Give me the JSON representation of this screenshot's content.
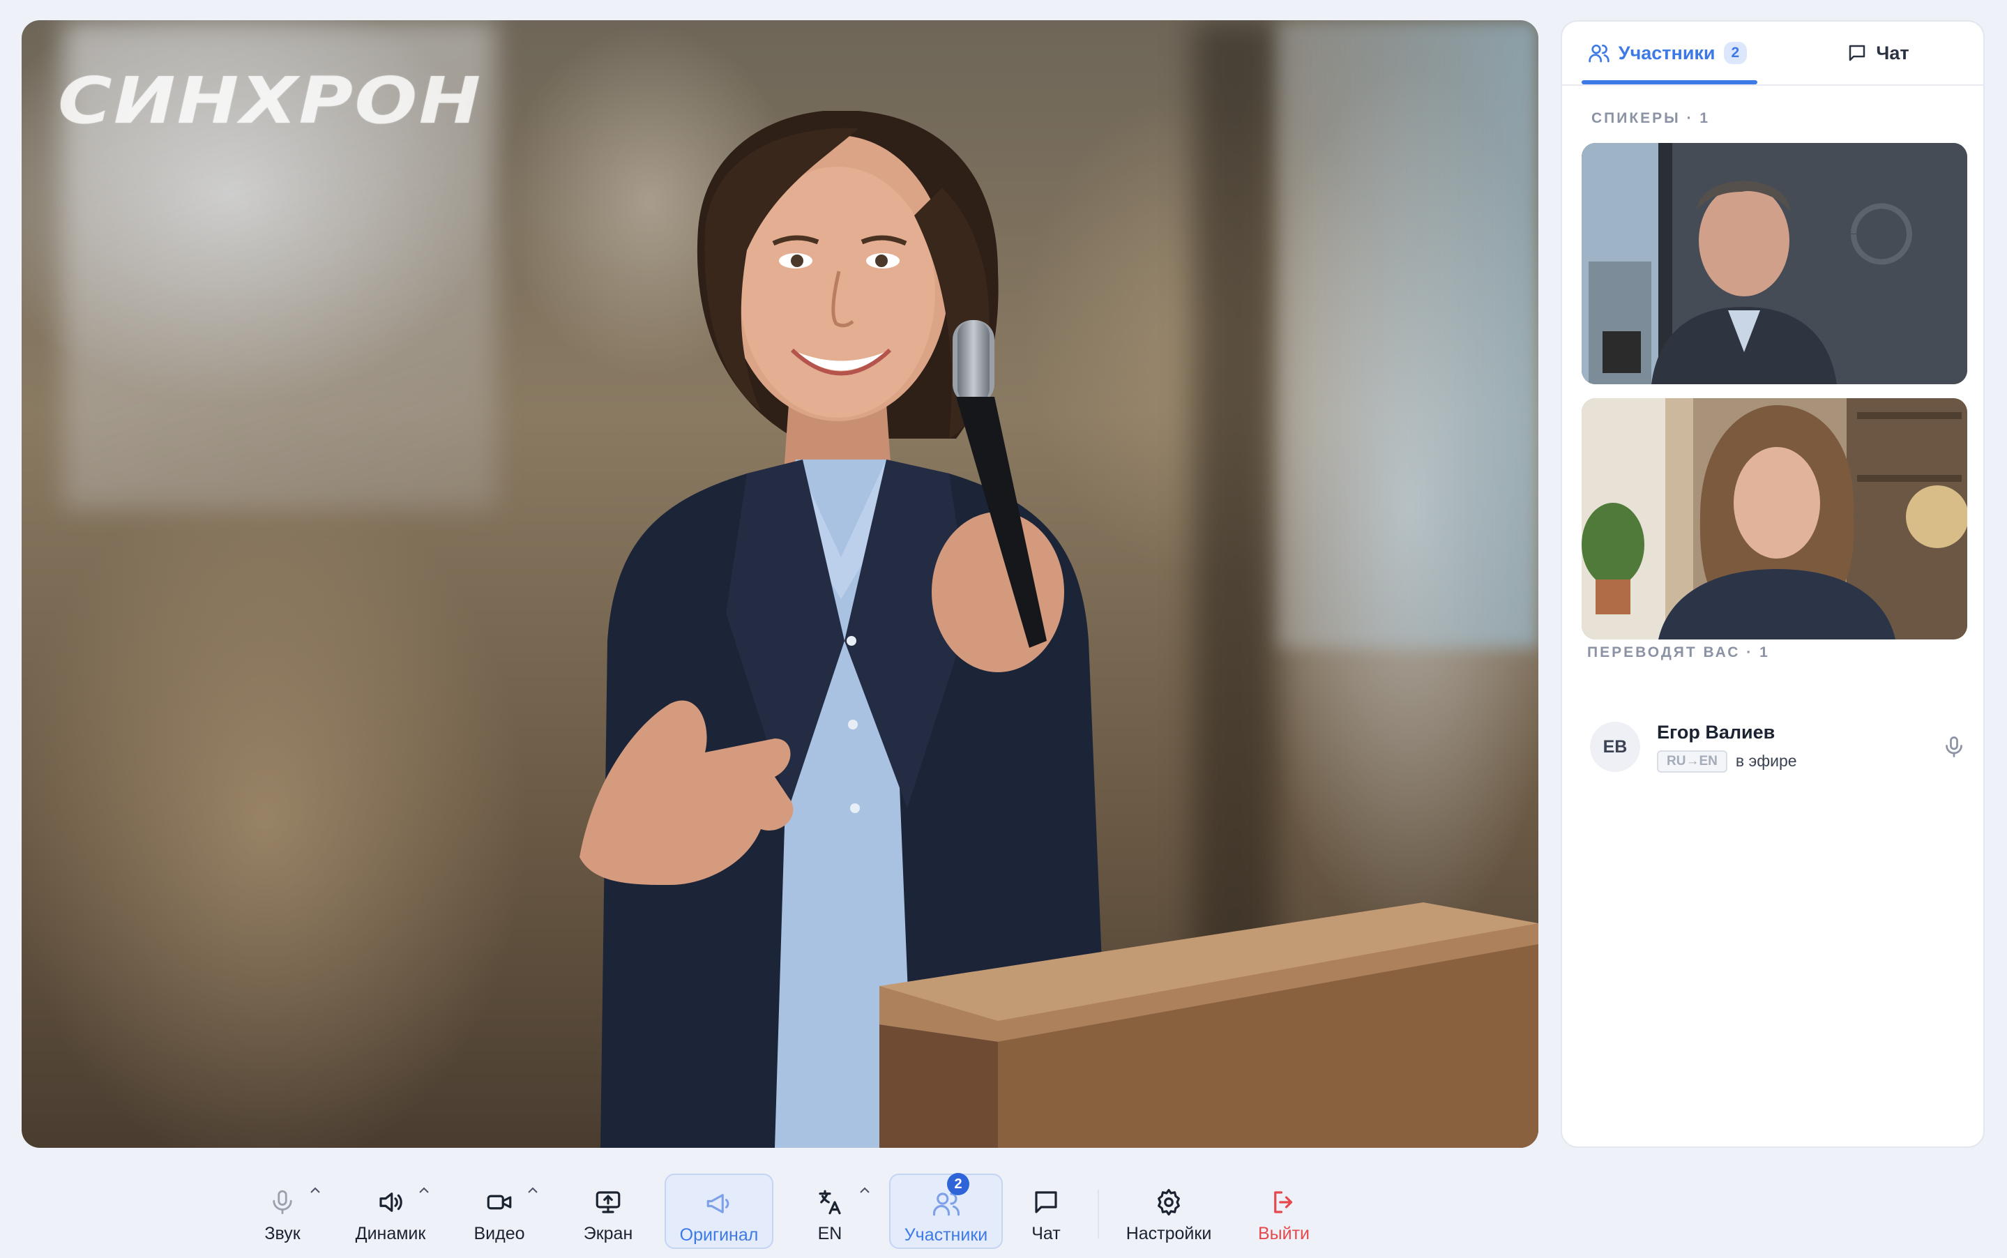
{
  "stage": {
    "logo_text": "СИНХРОН"
  },
  "panel": {
    "tabs": [
      {
        "label": "Участники",
        "count": "2",
        "active": true,
        "icon": "users-icon"
      },
      {
        "label": "Чат",
        "active": false,
        "icon": "chat-icon"
      }
    ],
    "speakers_title": "СПИКЕРЫ · 1",
    "translators_title": "ПЕРЕВОДЯТ ВАС · 1",
    "translator": {
      "initials": "ЕВ",
      "name": "Егор Валиев",
      "lang": "RU→EN",
      "status": "в эфире"
    }
  },
  "toolbar": {
    "sound": "Звук",
    "speaker": "Динамик",
    "video": "Видео",
    "screen": "Экран",
    "original": "Оригинал",
    "lang": "EN",
    "participants": "Участники",
    "participants_badge": "2",
    "chat": "Чат",
    "settings": "Настройки",
    "exit": "Выйти"
  },
  "colors": {
    "accent": "#3d7ae6",
    "danger": "#e5484d",
    "badge": "#2f64d8"
  }
}
